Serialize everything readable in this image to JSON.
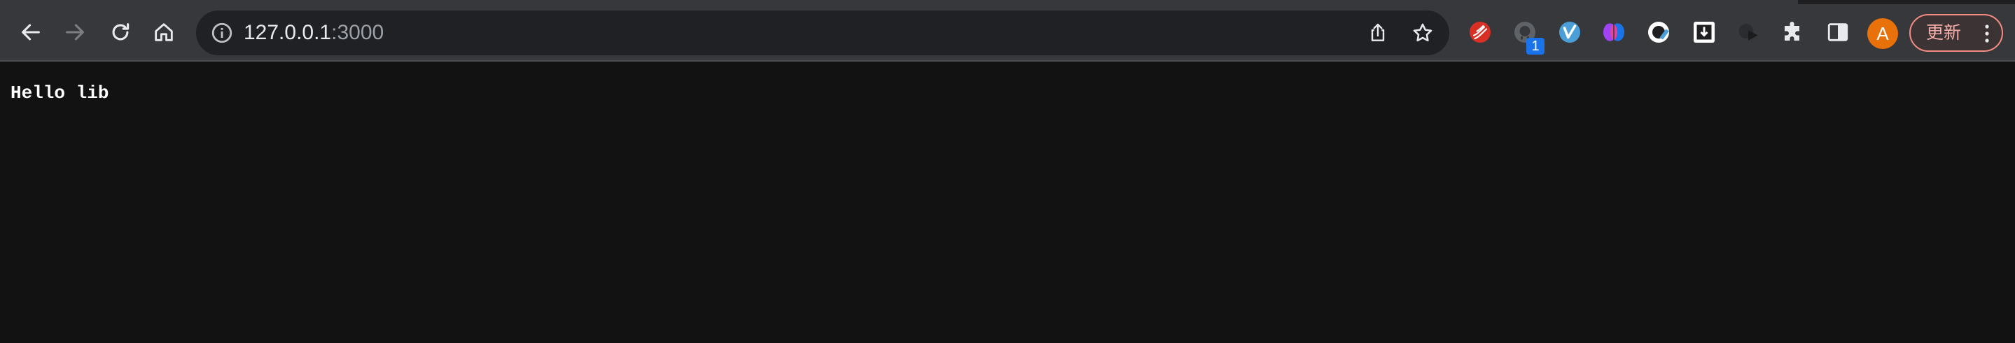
{
  "browser": {
    "url": {
      "host": "127.0.0.1",
      "port": ":3000"
    },
    "extensions": [
      {
        "icon": "red-stripes-extension-icon"
      },
      {
        "icon": "github-extension-icon",
        "badge": "1"
      },
      {
        "icon": "blue-v-extension-icon"
      },
      {
        "icon": "brain-extension-icon"
      },
      {
        "icon": "pen-circle-extension-icon"
      },
      {
        "icon": "dock-box-extension-icon"
      },
      {
        "icon": "dark-play-extension-icon"
      },
      {
        "icon": "puzzle-extensions-icon"
      },
      {
        "icon": "side-panel-icon"
      }
    ],
    "profile": {
      "initial": "A",
      "color": "#e8710a"
    },
    "update_button": {
      "label": "更新",
      "accent": "#f28b82"
    }
  },
  "page": {
    "text": "Hello lib",
    "background": "#121212"
  }
}
